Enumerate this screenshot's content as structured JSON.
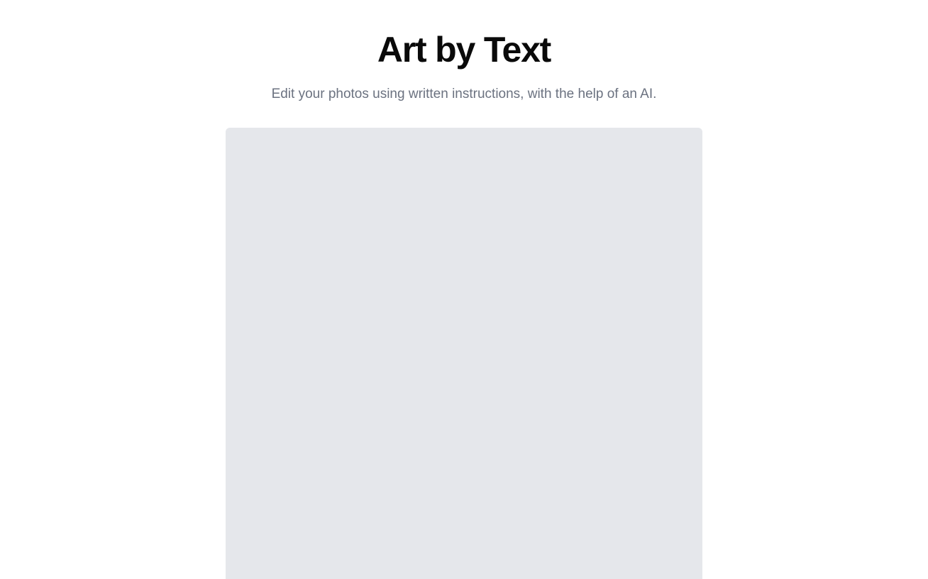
{
  "header": {
    "title": "Art by Text",
    "subtitle": "Edit your photos using written instructions, with the help of an AI."
  },
  "colors": {
    "background": "#ffffff",
    "title": "#0a0a0a",
    "subtitle": "#6b7280",
    "image_placeholder": "#e5e7eb"
  }
}
